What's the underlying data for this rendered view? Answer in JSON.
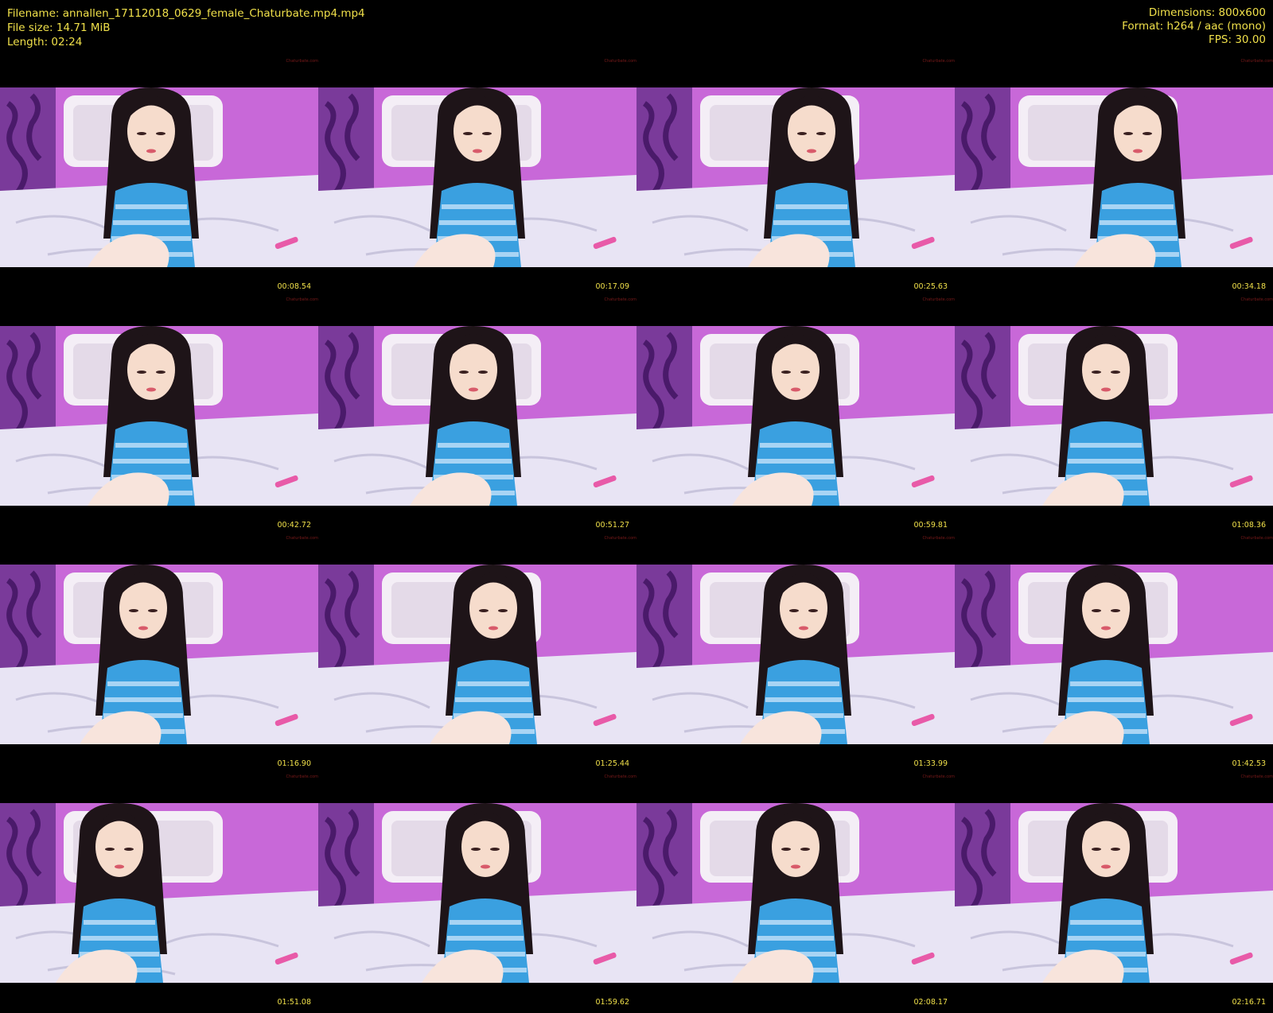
{
  "header": {
    "filename": "Filename: annallen_17112018_0629_female_Chaturbate.mp4.mp4",
    "file_size": "File size: 14.71 MiB",
    "length": "Length: 02:24",
    "dimensions": "Dimensions: 800x600",
    "format": "Format: h264 / aac (mono)",
    "fps": "FPS: 30.00"
  },
  "colors": {
    "text": "#f0e04a",
    "background": "#000000",
    "wall": "#c868d8",
    "sheet": "#e8e4f4",
    "dress": "#3aa0e0",
    "hair": "#1e1418"
  },
  "thumbnails": [
    {
      "timestamp": "00:08.54",
      "watermark": "Chaturbate.com"
    },
    {
      "timestamp": "00:17.09",
      "watermark": "Chaturbate.com"
    },
    {
      "timestamp": "00:25.63",
      "watermark": "Chaturbate.com"
    },
    {
      "timestamp": "00:34.18",
      "watermark": "Chaturbate.com"
    },
    {
      "timestamp": "00:42.72",
      "watermark": "Chaturbate.com"
    },
    {
      "timestamp": "00:51.27",
      "watermark": "Chaturbate.com"
    },
    {
      "timestamp": "00:59.81",
      "watermark": "Chaturbate.com"
    },
    {
      "timestamp": "01:08.36",
      "watermark": "Chaturbate.com"
    },
    {
      "timestamp": "01:16.90",
      "watermark": "Chaturbate.com"
    },
    {
      "timestamp": "01:25.44",
      "watermark": "Chaturbate.com"
    },
    {
      "timestamp": "01:33.99",
      "watermark": "Chaturbate.com"
    },
    {
      "timestamp": "01:42.53",
      "watermark": "Chaturbate.com"
    },
    {
      "timestamp": "01:51.08",
      "watermark": "Chaturbate.com"
    },
    {
      "timestamp": "01:59.62",
      "watermark": "Chaturbate.com"
    },
    {
      "timestamp": "02:08.17",
      "watermark": "Chaturbate.com"
    },
    {
      "timestamp": "02:16.71",
      "watermark": "Chaturbate.com"
    }
  ]
}
